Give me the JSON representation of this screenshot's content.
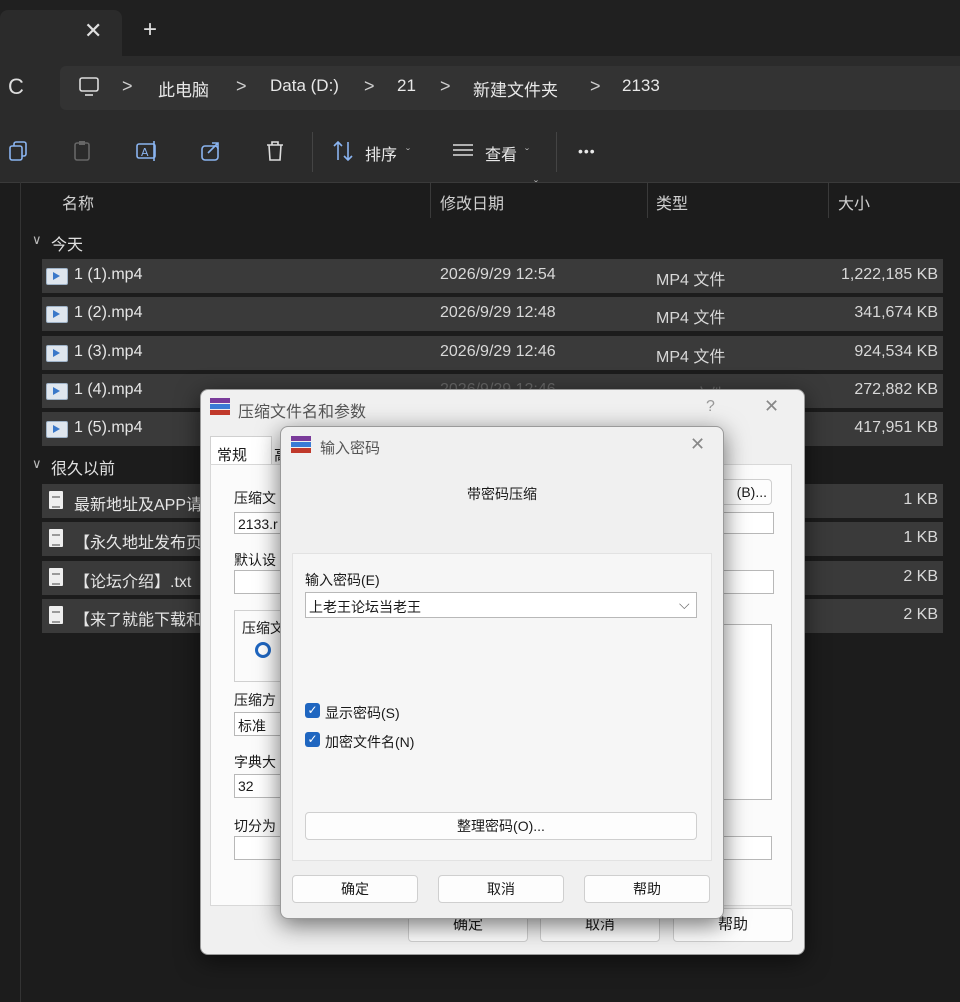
{
  "tabbar": {
    "close_glyph": "✕",
    "new_tab_glyph": "+"
  },
  "address": {
    "refresh_glyph": "C",
    "chevron": ">",
    "crumbs": [
      "此电脑",
      "Data (D:)",
      "21",
      "新建文件夹",
      "2133"
    ]
  },
  "toolbar": {
    "sort_label": "排序",
    "view_label": "查看",
    "more_label": "•••",
    "dropdown_glyph": "ˇ"
  },
  "filelist": {
    "columns": [
      "名称",
      "修改日期",
      "类型",
      "大小"
    ],
    "group_today": "今天",
    "group_old": "很久以前",
    "group_chevron": "∨",
    "today_files": [
      {
        "name": "1 (1).mp4",
        "date": "2026/9/29 12:54",
        "type": "MP4 文件",
        "size": "1,222,185 KB"
      },
      {
        "name": "1 (2).mp4",
        "date": "2026/9/29 12:48",
        "type": "MP4 文件",
        "size": "341,674 KB"
      },
      {
        "name": "1 (3).mp4",
        "date": "2026/9/29 12:46",
        "type": "MP4 文件",
        "size": "924,534 KB"
      },
      {
        "name": "1 (4).mp4",
        "date": "2026/9/29 12:46",
        "type": "MP4 文件",
        "size": "272,882 KB"
      },
      {
        "name": "1 (5).mp4",
        "date": "",
        "type": "",
        "size": "417,951 KB"
      }
    ],
    "old_files": [
      {
        "name": "最新地址及APP请",
        "size": "1 KB"
      },
      {
        "name": "【永久地址发布页",
        "size": "1 KB"
      },
      {
        "name": "【论坛介绍】.txt",
        "size": "2 KB"
      },
      {
        "name": "【来了就能下载和",
        "size": "2 KB"
      }
    ]
  },
  "archive_dialog": {
    "title": "压缩文件名和参数",
    "help_glyph": "?",
    "close_glyph": "✕",
    "tab_general": "常规",
    "tab_partial": "高",
    "archive_name_label": "压缩文",
    "archive_name_value": "2133.r",
    "browse_button": "(B)...",
    "default_label": "默认设",
    "format_label": "压缩文",
    "method_label": "压缩方",
    "method_value": "标准",
    "dict_label": "字典大",
    "dict_value": "32",
    "split_label": "切分为",
    "ok_button": "确定",
    "cancel_button": "取消",
    "help_button": "帮助"
  },
  "password_dialog": {
    "title": "输入密码",
    "close_glyph": "✕",
    "subtitle": "带密码压缩",
    "password_label": "输入密码(E)",
    "password_value": "上老王论坛当老王",
    "show_password_label": "显示密码(S)",
    "encrypt_names_label": "加密文件名(N)",
    "check_glyph": "✓",
    "dropdown_glyph": "⌵",
    "organize_button": "整理密码(O)...",
    "ok_button": "确定",
    "cancel_button": "取消",
    "help_button": "帮助"
  },
  "colors": {
    "accent": "#1f66c0",
    "row_bg": "#3a3a3a",
    "window_bg": "#1c1c1c",
    "dialog_bg": "#f0f0f0"
  }
}
